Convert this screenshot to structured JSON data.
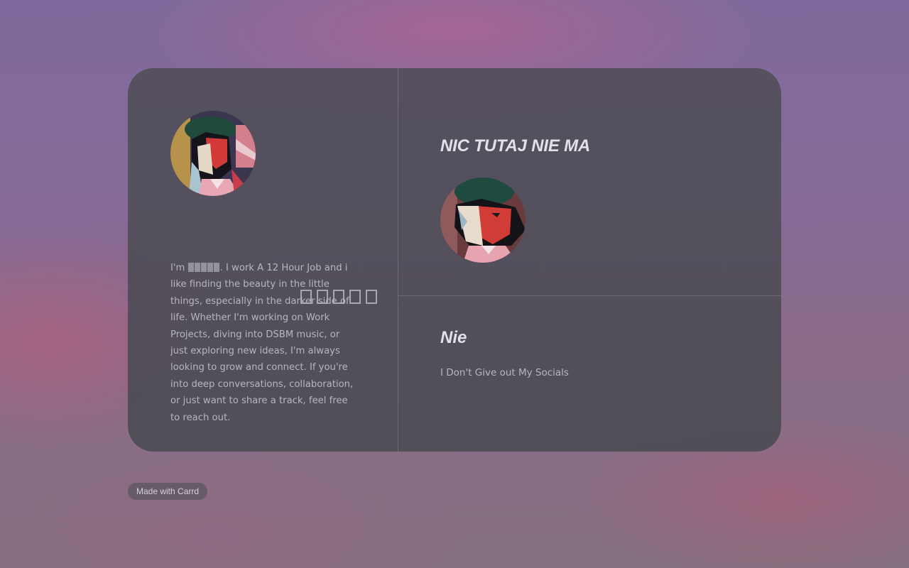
{
  "profile": {
    "name_placeholder_count": 5,
    "bio_prefix": "I'm ",
    "bio_rest": ". I work A 12 Hour Job and i like finding the beauty in the little things, especially in the darker side of life. Whether I'm working on Work Projects, diving into DSBM music, or just exploring new ideas, I'm always looking to grow and connect. If you're into deep conversations, collaboration, or just want to share a track, feel free to reach out."
  },
  "main": {
    "title": "NIC TUTAJ NIE MA",
    "section_title": "Nie",
    "section_text": "I Don't Give out My Socials"
  },
  "footer": {
    "badge_label": "Made with Carrd"
  },
  "colors": {
    "card_bg": "#504d58",
    "text_light": "#e3e1e7",
    "text_muted": "#b8b5bd"
  }
}
